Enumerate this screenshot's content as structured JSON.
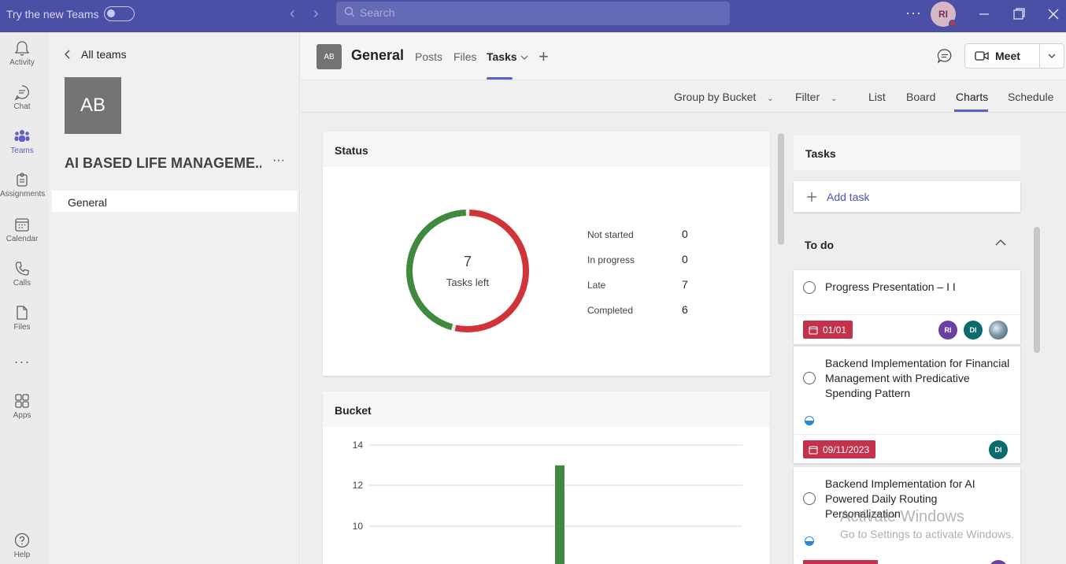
{
  "titlebar": {
    "try_new_teams": "Try the new Teams",
    "search_placeholder": "Search",
    "avatar_initials": "RI"
  },
  "rail": {
    "items": [
      {
        "label": "Activity",
        "icon": "bell-icon"
      },
      {
        "label": "Chat",
        "icon": "chat-icon"
      },
      {
        "label": "Teams",
        "icon": "teams-icon"
      },
      {
        "label": "Assignments",
        "icon": "assignments-icon"
      },
      {
        "label": "Calendar",
        "icon": "calendar-icon"
      },
      {
        "label": "Calls",
        "icon": "phone-icon"
      },
      {
        "label": "Files",
        "icon": "file-icon"
      },
      {
        "label": "Apps",
        "icon": "apps-icon"
      },
      {
        "label": "Help",
        "icon": "help-icon"
      }
    ],
    "active": "Teams"
  },
  "team_panel": {
    "back_label": "All teams",
    "team_initials": "AB",
    "team_name": "AI BASED LIFE MANAGEME...",
    "channels": [
      "General"
    ]
  },
  "header": {
    "channel_initials": "AB",
    "channel_title": "General",
    "tabs": [
      "Posts",
      "Files",
      "Tasks"
    ],
    "active_tab": "Tasks",
    "meet_label": "Meet"
  },
  "toolbar": {
    "group_by": "Group by Bucket",
    "filter": "Filter",
    "views": [
      "List",
      "Board",
      "Charts",
      "Schedule"
    ],
    "active_view": "Charts"
  },
  "status_card": {
    "title": "Status",
    "center_value": "7",
    "center_label": "Tasks left",
    "legend": [
      {
        "label": "Not started",
        "value": "0"
      },
      {
        "label": "In progress",
        "value": "0"
      },
      {
        "label": "Late",
        "value": "7"
      },
      {
        "label": "Completed",
        "value": "6"
      }
    ],
    "colors": {
      "late": "#d13438",
      "completed": "#3f8a3e"
    }
  },
  "bucket_card": {
    "title": "Bucket"
  },
  "chart_data": [
    {
      "type": "pie",
      "title": "Status",
      "categories": [
        "Not started",
        "In progress",
        "Late",
        "Completed"
      ],
      "values": [
        0,
        0,
        7,
        6
      ]
    },
    {
      "type": "bar",
      "title": "Bucket",
      "y_ticks": [
        "14",
        "12",
        "10"
      ],
      "ylim": [
        8,
        14
      ],
      "values": [
        13
      ]
    }
  ],
  "tasks_panel": {
    "title": "Tasks",
    "add_task": "Add task",
    "group_label": "To do",
    "tasks": [
      {
        "title": "Progress Presentation – I I",
        "due": "01/01",
        "assignees": [
          "RI",
          "DI",
          ""
        ]
      },
      {
        "title": "Backend Implementation for Financial Management with Predicative Spending Pattern",
        "due": "09/11/2023",
        "assignees": [
          "DI"
        ]
      },
      {
        "title": "Backend Implementation for AI Powered Daily Routing Personalization"
      }
    ]
  },
  "watermark": {
    "line1": "Activate Windows",
    "line2": "Go to Settings to activate Windows."
  }
}
